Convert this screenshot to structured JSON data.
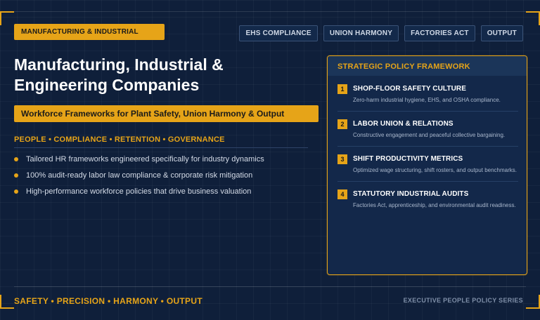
{
  "header": {
    "badge": "MANUFACTURING & INDUSTRIAL",
    "tags": [
      "EHS COMPLIANCE",
      "UNION HARMONY",
      "FACTORIES ACT",
      "OUTPUT"
    ]
  },
  "hero": {
    "title_line1": "Manufacturing, Industrial &",
    "title_line2": "Engineering Companies",
    "subtitle": "Workforce Frameworks for Plant Safety, Union Harmony & Output",
    "pillars": "PEOPLE • COMPLIANCE • RETENTION • GOVERNANCE",
    "bullets": [
      "Tailored HR frameworks engineered specifically for industry dynamics",
      "100% audit-ready labor law compliance & corporate risk mitigation",
      "High-performance workforce policies that drive business valuation"
    ]
  },
  "panel": {
    "title": "STRATEGIC POLICY FRAMEWORK",
    "items": [
      {
        "num": "1",
        "title": "SHOP-FLOOR SAFETY CULTURE",
        "desc": "Zero-harm industrial hygiene, EHS, and OSHA compliance."
      },
      {
        "num": "2",
        "title": "LABOR UNION & RELATIONS",
        "desc": "Constructive engagement and peaceful collective bargaining."
      },
      {
        "num": "3",
        "title": "SHIFT PRODUCTIVITY METRICS",
        "desc": "Optimized wage structuring, shift rosters, and output benchmarks."
      },
      {
        "num": "4",
        "title": "STATUTORY INDUSTRIAL AUDITS",
        "desc": "Factories Act, apprenticeship, and environmental audit readiness."
      }
    ]
  },
  "footer": {
    "left": "SAFETY • PRECISION • HARMONY • OUTPUT",
    "right": "EXECUTIVE PEOPLE POLICY SERIES"
  },
  "colors": {
    "background": "#0f1f3a",
    "accent": "#e6a418",
    "panel": "#13284a"
  }
}
